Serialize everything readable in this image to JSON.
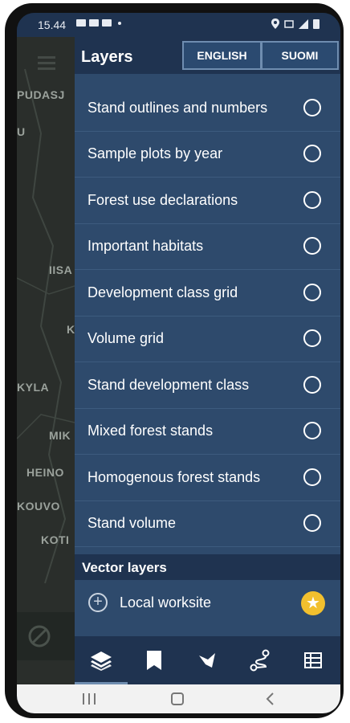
{
  "status": {
    "time": "15.44"
  },
  "header": {
    "title": "Layers",
    "lang_english": "ENGLISH",
    "lang_suomi": "SUOMI"
  },
  "layers": [
    {
      "label": "Stand outlines and numbers",
      "selected": false
    },
    {
      "label": "Sample plots by year",
      "selected": false
    },
    {
      "label": "Forest use declarations",
      "selected": false
    },
    {
      "label": "Important habitats",
      "selected": false
    },
    {
      "label": "Development class grid",
      "selected": false
    },
    {
      "label": "Volume grid",
      "selected": false
    },
    {
      "label": "Stand development class",
      "selected": false
    },
    {
      "label": "Mixed forest stands",
      "selected": false
    },
    {
      "label": "Homogenous forest stands",
      "selected": false
    },
    {
      "label": "Stand volume",
      "selected": false
    }
  ],
  "vector": {
    "title": "Vector layers",
    "item_label": "Local worksite",
    "item_starred": true
  },
  "map_labels": [
    "PUDASJ",
    "IISA",
    "KYLA",
    "MIK",
    "HEINO",
    "KOUVO",
    "KOTI"
  ],
  "tabs": [
    {
      "icon": "layers-icon",
      "active": true
    },
    {
      "icon": "bookmark-icon",
      "active": false
    },
    {
      "icon": "map-flag-icon",
      "active": false
    },
    {
      "icon": "route-icon",
      "active": false
    },
    {
      "icon": "table-icon",
      "active": false
    }
  ],
  "colors": {
    "panel": "#2e4a6c",
    "header": "#1f3350",
    "star": "#f2c02e"
  }
}
